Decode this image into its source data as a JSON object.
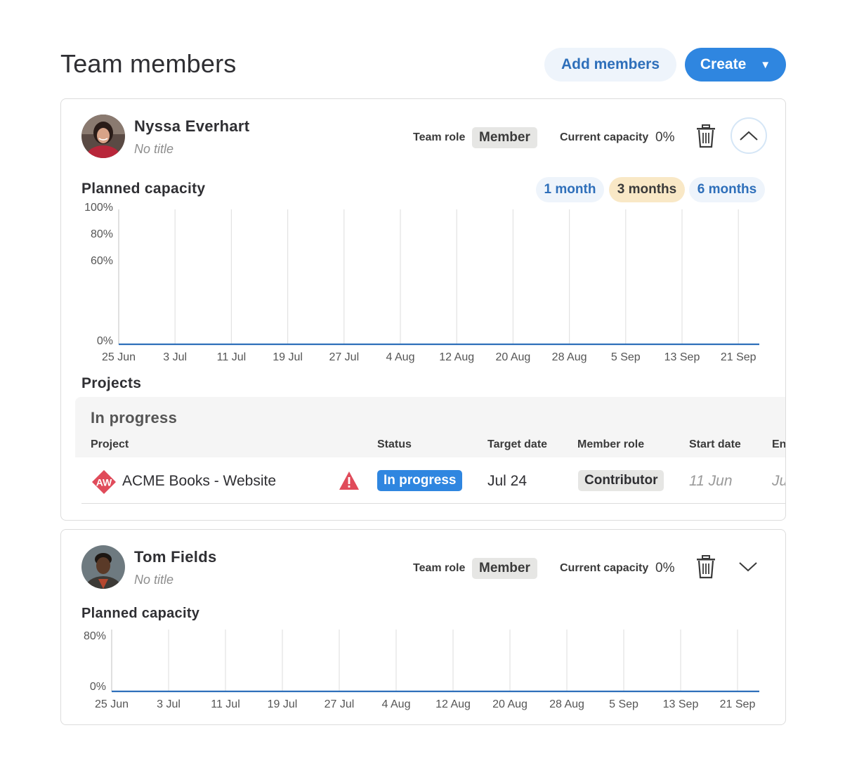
{
  "page": {
    "title": "Team members",
    "add_members_label": "Add members",
    "create_label": "Create"
  },
  "members": [
    {
      "name": "Nyssa Everhart",
      "title": "No title",
      "team_role_label": "Team role",
      "team_role": "Member",
      "capacity_label": "Current capacity",
      "capacity": "0%",
      "expanded": true,
      "planned_capacity_title": "Planned capacity",
      "ranges": [
        "1 month",
        "3 months",
        "6 months"
      ],
      "selected_range": "3 months",
      "projects_title": "Projects",
      "projects_group": "In progress",
      "columns": [
        "Project",
        "Status",
        "Target date",
        "Member role",
        "Start date",
        "En"
      ],
      "projects": [
        {
          "icon_initials": "AW",
          "name": "ACME Books - Website",
          "warning": "warning-icon",
          "status": "In progress",
          "target_date": "Jul 24",
          "member_role": "Contributor",
          "start_date": "11 Jun",
          "end_date": "Ju"
        }
      ]
    },
    {
      "name": "Tom Fields",
      "title": "No title",
      "team_role_label": "Team role",
      "team_role": "Member",
      "capacity_label": "Current capacity",
      "capacity": "0%",
      "expanded": false,
      "planned_capacity_title": "Planned capacity"
    }
  ],
  "chart_data": [
    {
      "type": "line",
      "x": [
        "25 Jun",
        "3 Jul",
        "11 Jul",
        "19 Jul",
        "27 Jul",
        "4 Aug",
        "12 Aug",
        "20 Aug",
        "28 Aug",
        "5 Sep",
        "13 Sep",
        "21 Sep"
      ],
      "y_ticks": [
        "100%",
        "80%",
        "60%",
        "0%"
      ],
      "series": [
        {
          "values": [
            0,
            0,
            0,
            0,
            0,
            0,
            0,
            0,
            0,
            0,
            0,
            0
          ]
        }
      ],
      "ylim": [
        0,
        100
      ],
      "grid": "vertical",
      "line_color": "#2e6fba"
    },
    {
      "type": "line",
      "x": [
        "25 Jun",
        "3 Jul",
        "11 Jul",
        "19 Jul",
        "27 Jul",
        "4 Aug",
        "12 Aug",
        "20 Aug",
        "28 Aug",
        "5 Sep",
        "13 Sep",
        "21 Sep"
      ],
      "y_ticks": [
        "80%",
        "0%"
      ],
      "series": [
        {
          "values": [
            0,
            0,
            0,
            0,
            0,
            0,
            0,
            0,
            0,
            0,
            0,
            0
          ]
        }
      ],
      "ylim": [
        0,
        80
      ],
      "grid": "vertical",
      "line_color": "#2e6fba"
    }
  ],
  "colors": {
    "primary": "#2f86e0",
    "primary_soft": "#eef4fb",
    "selected_range": "#f9e8c6",
    "warning": "#e04b5a",
    "project_icon": "#e04b5a"
  }
}
